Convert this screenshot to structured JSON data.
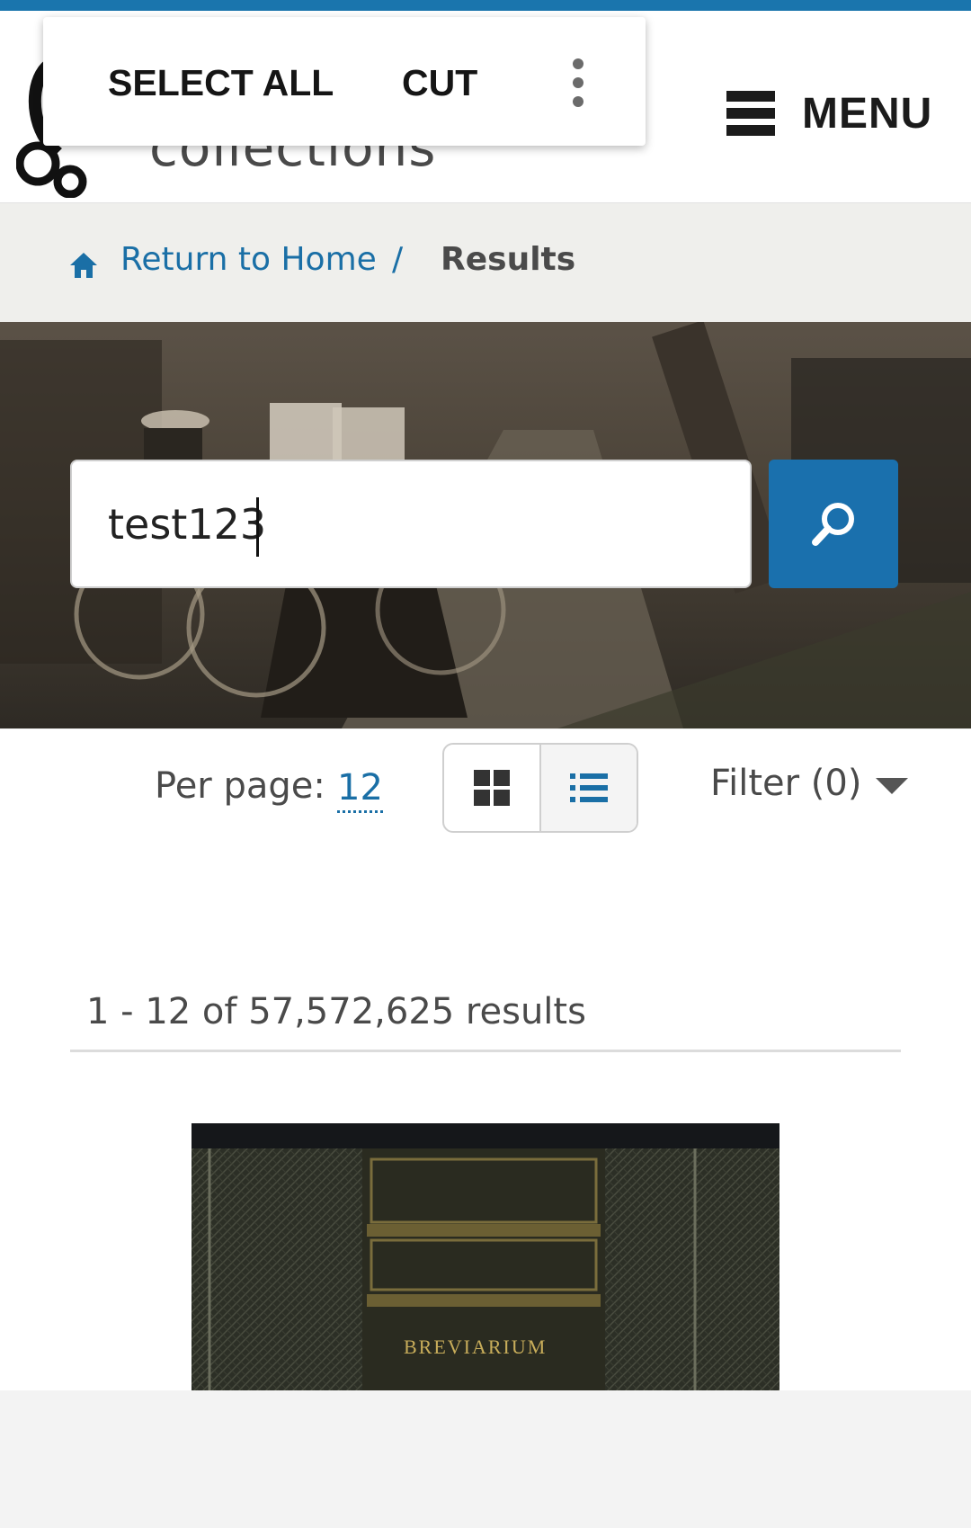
{
  "header": {
    "logo_text": "collections",
    "menu_label": "MENU"
  },
  "context_menu": {
    "select_all": "SELECT ALL",
    "cut": "CUT"
  },
  "breadcrumb": {
    "home_label": "Return to Home",
    "separator": "/",
    "current": "Results"
  },
  "search": {
    "value": "test123"
  },
  "toolbar": {
    "per_page_label": "Per page:",
    "per_page_value": "12",
    "filter_label": "Filter (0)"
  },
  "results": {
    "count_text": "1 - 12 of 57,572,625 results",
    "first_item_spine_text": "BREVIARIUM"
  },
  "colors": {
    "accent": "#1a70ad",
    "link": "#1a6fa6",
    "text": "#4a4a4a"
  },
  "icons": [
    "home-icon",
    "search-icon",
    "grid-view-icon",
    "list-view-icon",
    "hamburger-icon",
    "more-vert-icon",
    "chevron-down-icon"
  ]
}
